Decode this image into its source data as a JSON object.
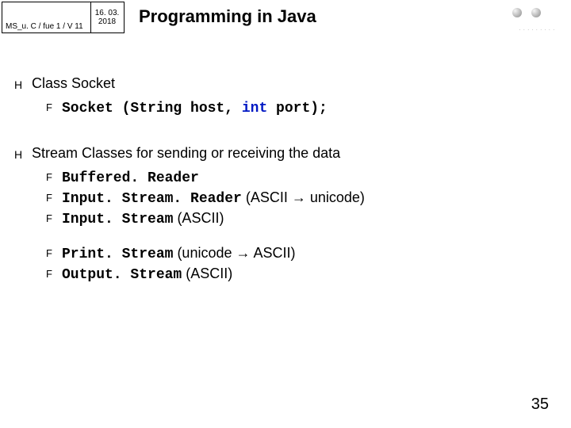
{
  "meta": {
    "course": "MS_u. C / fue 1 / V 11",
    "date_top": "16. 03.",
    "date_bottom": "2018"
  },
  "title": "Programming in Java",
  "sections": [
    {
      "heading": "Class Socket",
      "items": [
        {
          "code": "Socket (String host, ",
          "kw": "int",
          "code2": " port);"
        }
      ]
    },
    {
      "heading": "Stream Classes for sending or receiving the data",
      "items": [
        {
          "code": "Buffered. Reader"
        },
        {
          "code": "Input. Stream. Reader",
          "note_pre": " (ASCII ",
          "arrow": "→",
          "note_post": " unicode)"
        },
        {
          "code": "Input. Stream",
          "note_pre": " (ASCII)"
        }
      ],
      "items2": [
        {
          "code": "Print. Stream",
          "note_pre": " (unicode ",
          "arrow": "→",
          "note_post": " ASCII)"
        },
        {
          "code": "Output. Stream",
          "note_pre": " (ASCII)"
        }
      ]
    }
  ],
  "page": "35",
  "glyphs": {
    "z": "H",
    "y": "F",
    "dots": ". . . . . . . . ."
  }
}
